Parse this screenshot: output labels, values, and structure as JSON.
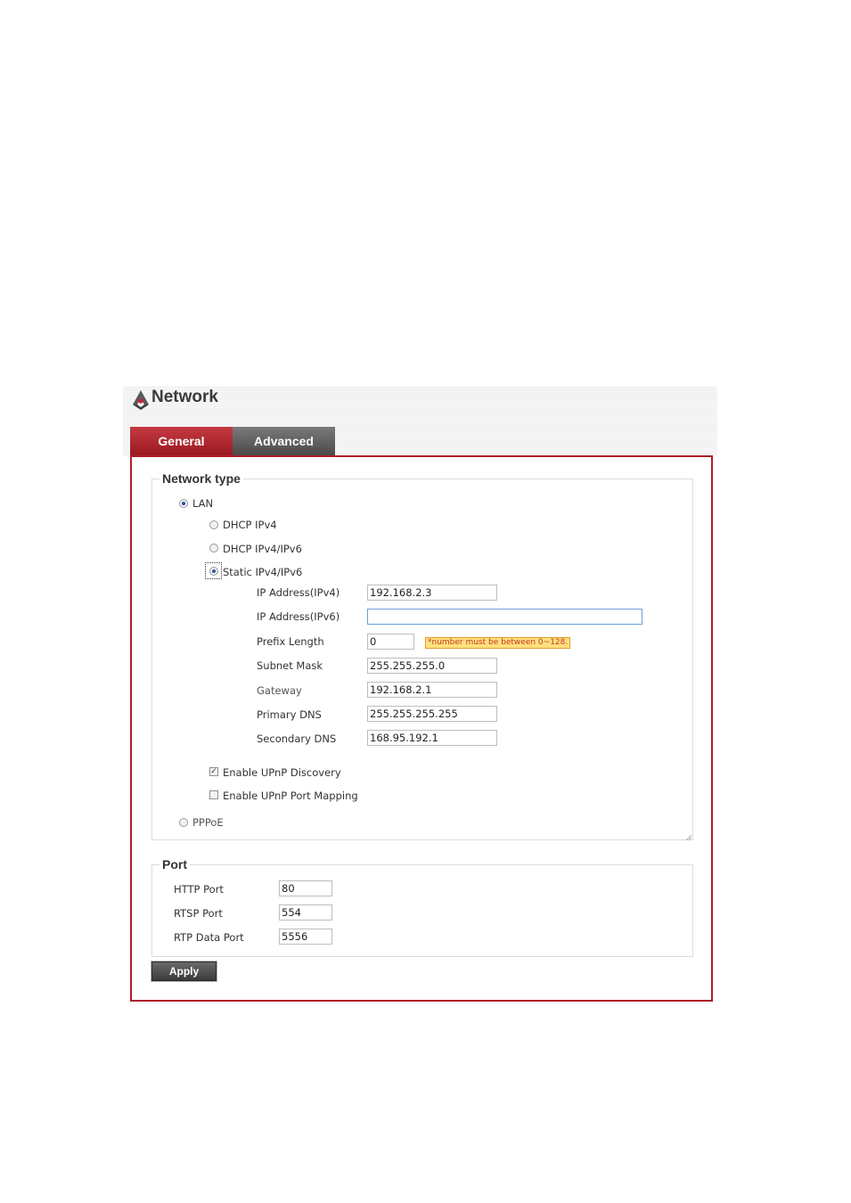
{
  "app": {
    "title": "Network"
  },
  "tabs": [
    {
      "label": "General",
      "active": true
    },
    {
      "label": "Advanced",
      "active": false
    }
  ],
  "network_type": {
    "legend": "Network type",
    "lan_label": "LAN",
    "dhcp_ipv4_label": "DHCP IPv4",
    "dhcp_ipv4v6_label": "DHCP IPv4/IPv6",
    "static_label": "Static IPv4/IPv6",
    "selected": "Static IPv4/IPv6",
    "fields": {
      "ip_v4": {
        "label": "IP Address(IPv4)",
        "value": "192.168.2.3"
      },
      "ip_v6": {
        "label": "IP Address(IPv6)",
        "value": ""
      },
      "prefix": {
        "label": "Prefix Length",
        "value": "0",
        "hint": "*number must be between 0~128."
      },
      "subnet": {
        "label": "Subnet Mask",
        "value": "255.255.255.0"
      },
      "gateway": {
        "label": "Gateway",
        "value": "192.168.2.1"
      },
      "dns1": {
        "label": "Primary DNS",
        "value": "255.255.255.255"
      },
      "dns2": {
        "label": "Secondary DNS",
        "value": "168.95.192.1"
      }
    },
    "upnp_discovery": {
      "label": "Enable UPnP Discovery",
      "checked": true
    },
    "upnp_port_mapping": {
      "label": "Enable UPnP Port Mapping",
      "checked": false
    },
    "pppoe_label": "PPPoE"
  },
  "port": {
    "legend": "Port",
    "http": {
      "label": "HTTP Port",
      "value": "80"
    },
    "rtsp": {
      "label": "RTSP Port",
      "value": "554"
    },
    "rtp": {
      "label": "RTP Data Port",
      "value": "5556"
    }
  },
  "apply_label": "Apply",
  "colors": {
    "accent_red": "#b01e2a",
    "tab_active": "#9b1a22",
    "tab_inactive": "#4a4a4a",
    "hint_bg": "#ffe17d"
  }
}
